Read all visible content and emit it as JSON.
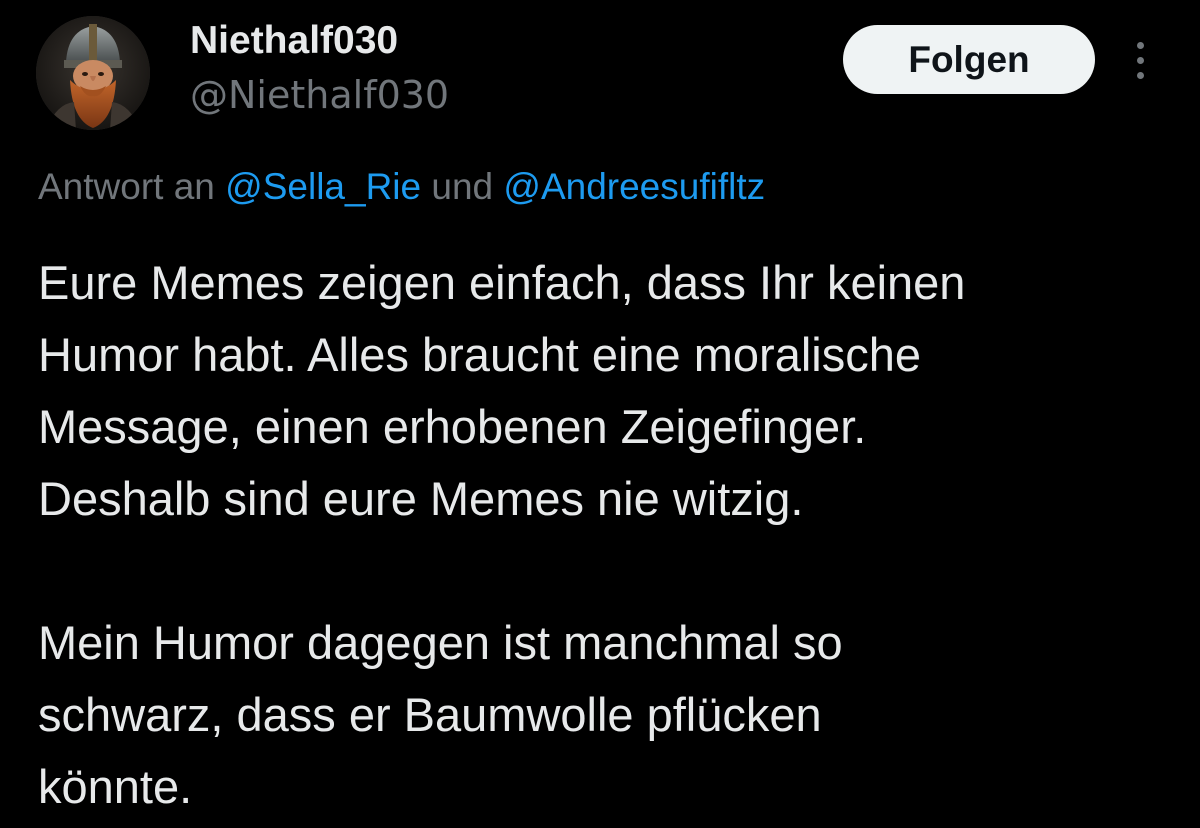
{
  "author": {
    "display_name": "Niethalf030",
    "handle": "@Niethalf030",
    "avatar_icon": "dwarf-warrior-avatar"
  },
  "actions": {
    "follow_label": "Folgen",
    "more_icon": "more-vertical-icon"
  },
  "reply": {
    "prefix": "Antwort an ",
    "mention_1": "@Sella_Rie",
    "connector": " und ",
    "mention_2": "@Andreesufifltz"
  },
  "tweet": {
    "paragraph_1": "Eure Memes zeigen einfach, dass Ihr keinen\nHumor habt. Alles braucht eine moralische\nMessage, einen erhobenen Zeigefinger.\nDeshalb sind eure Memes nie witzig.",
    "paragraph_2": "Mein Humor dagegen ist manchmal so\nschwarz, dass er Baumwolle pflücken\nkönnte."
  },
  "colors": {
    "background": "#000000",
    "text_primary": "#e7e9ea",
    "text_secondary": "#71767b",
    "accent": "#1d9bf0",
    "button_bg": "#eff3f4",
    "button_text": "#0f1419"
  }
}
